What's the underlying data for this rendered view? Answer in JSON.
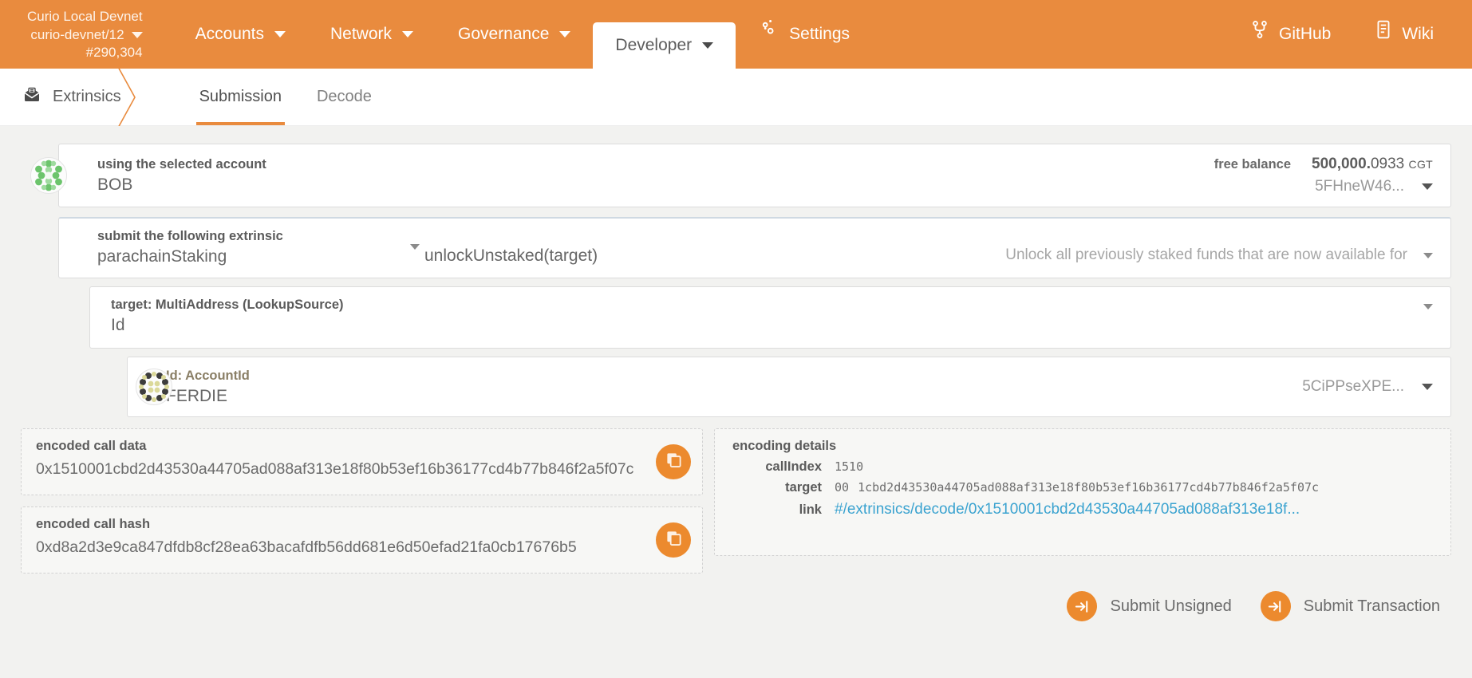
{
  "header": {
    "chain": {
      "name": "Curio Local Devnet",
      "node": "curio-devnet/12",
      "block": "#290,304"
    },
    "nav": [
      {
        "label": "Accounts",
        "icon": "chevron-down-icon",
        "active": false
      },
      {
        "label": "Network",
        "icon": "chevron-down-icon",
        "active": false
      },
      {
        "label": "Governance",
        "icon": "chevron-down-icon",
        "active": false
      },
      {
        "label": "Developer",
        "icon": "chevron-down-icon",
        "active": true
      }
    ],
    "settings": {
      "label": "Settings",
      "icon": "gear-icon"
    },
    "github": {
      "label": "GitHub",
      "icon": "github-icon"
    },
    "wiki": {
      "label": "Wiki",
      "icon": "book-icon"
    }
  },
  "breadcrumb": {
    "label": "Extrinsics",
    "icon": "extrinsics-icon"
  },
  "tabs": [
    {
      "label": "Submission",
      "active": true
    },
    {
      "label": "Decode",
      "active": false
    }
  ],
  "account": {
    "label": "using the selected account",
    "value": "BOB",
    "balance_label": "free balance",
    "balance_whole": "500,000.",
    "balance_frac": "0933",
    "balance_unit": "CGT",
    "address": "5FHneW46...",
    "identicon": "polkadot-identicon-green"
  },
  "extrinsic": {
    "label": "submit the following extrinsic",
    "pallet": "parachainStaking",
    "method": "unlockUnstaked(target)",
    "docs": "Unlock all previously staked funds that are now available for"
  },
  "target": {
    "label": "target: MultiAddress (LookupSource)",
    "value": "Id"
  },
  "target_id": {
    "label": "Id: AccountId",
    "value": "FERDIE",
    "address": "5CiPPseXPE...",
    "identicon": "polkadot-identicon-khaki"
  },
  "encoded": {
    "call_data_title": "encoded call data",
    "call_data": "0x1510001cbd2d43530a44705ad088af313e18f80b53ef16b36177cd4b77b846f2a5f07c",
    "call_hash_title": "encoded call hash",
    "call_hash": "0xd8a2d3e9ca847dfdb8cf28ea63bacafdfb56dd681e6d50efad21fa0cb17676b5",
    "copy_icon": "copy-icon"
  },
  "details": {
    "title": "encoding details",
    "rows": [
      {
        "key": "callIndex",
        "prefix": "",
        "value": "1510",
        "is_link": false
      },
      {
        "key": "target",
        "prefix": "00",
        "value": "1cbd2d43530a44705ad088af313e18f80b53ef16b36177cd4b77b846f2a5f07c",
        "is_link": false
      },
      {
        "key": "link",
        "prefix": "",
        "value": "#/extrinsics/decode/0x1510001cbd2d43530a44705ad088af313e18f...",
        "is_link": true
      }
    ]
  },
  "actions": {
    "submit_unsigned": "Submit Unsigned",
    "submit_transaction": "Submit Transaction",
    "icon": "sign-in-arrow-icon"
  },
  "colors": {
    "brand_orange": "#e98b3e",
    "accent_orange": "#ec8a2e",
    "link_blue": "#3ba3d0",
    "panel_bg": "#f2f2f0"
  }
}
